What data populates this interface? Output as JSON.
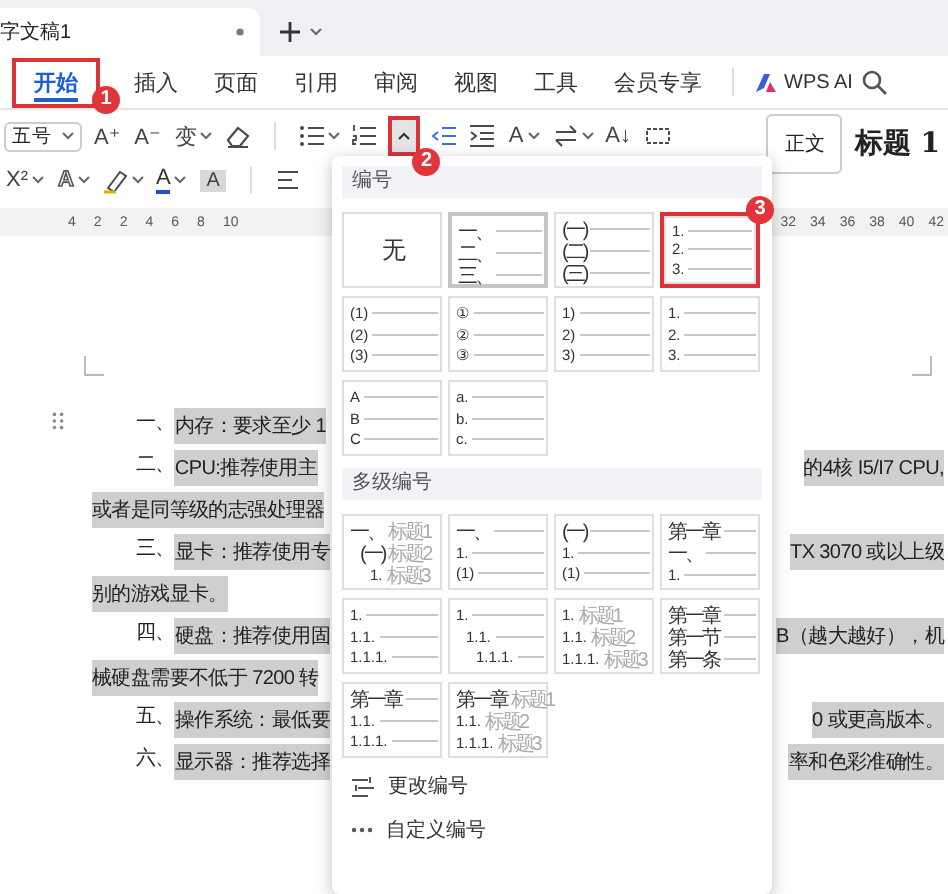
{
  "document_tab": {
    "title": "字文稿1"
  },
  "ribbon_tabs": [
    {
      "label": "开始",
      "selected": true,
      "callout": "1"
    },
    {
      "label": "插入",
      "selected": false
    },
    {
      "label": "页面",
      "selected": false
    },
    {
      "label": "引用",
      "selected": false
    },
    {
      "label": "审阅",
      "selected": false
    },
    {
      "label": "视图",
      "selected": false
    },
    {
      "label": "工具",
      "selected": false
    },
    {
      "label": "会员专享",
      "selected": false
    }
  ],
  "ai_button": {
    "label": "WPS AI"
  },
  "toolbar": {
    "font_size": "五号",
    "glyphs": [
      {
        "label": "A⁺",
        "kind": "plain"
      },
      {
        "label": "A⁻",
        "kind": "plain"
      },
      {
        "label": "变",
        "kind": "plain"
      },
      {
        "label": "A",
        "kind": "plain"
      },
      {
        "label": "A↓",
        "kind": "plain"
      },
      {
        "label": "X²",
        "kind": "plain"
      },
      {
        "label": "A",
        "kind": "outline"
      },
      {
        "label": "A",
        "kind": "underline"
      },
      {
        "label": "A",
        "kind": "shaded"
      }
    ],
    "numbering_toggle": {
      "expanded": true,
      "callout": "2"
    }
  },
  "styles": [
    {
      "label": "正文",
      "kind": "normal"
    },
    {
      "label": "标题 1",
      "kind": "heading"
    }
  ],
  "ruler": {
    "left_ticks": [
      "4",
      "2",
      "2",
      "4",
      "6",
      "8",
      "10"
    ],
    "right_ticks": [
      "32",
      "34",
      "36",
      "38",
      "40",
      "42"
    ]
  },
  "document": {
    "lines": [
      {
        "prefix": "一、",
        "left": "内存：要求至少 1"
      },
      {
        "prefix": "二、",
        "left": "CPU:推荐使用主",
        "right": "的4核 I5/I7 CPU,"
      },
      {
        "left": "或者是同等级的志强处理器"
      },
      {
        "prefix": "三、",
        "left": "显卡：推荐使用专",
        "right": "TX 3070 或以上级"
      },
      {
        "left": "别的游戏显卡。"
      },
      {
        "prefix": "四、",
        "left": "硬盘：推荐使用固",
        "right": "B（越大越好），机"
      },
      {
        "left": "械硬盘需要不低于 7200 转"
      },
      {
        "prefix": "五、",
        "left": "操作系统：最低要",
        "right": "0 或更高版本。"
      },
      {
        "prefix": "六、",
        "left": "显示器：推荐选择",
        "right": "率和色彩准确性。"
      }
    ]
  },
  "numbering_menu": {
    "title": "编号",
    "options": [
      {
        "kind": "none",
        "label": "无",
        "selected": false
      },
      {
        "kind": "list",
        "lines": [
          "一、",
          "二、",
          "三、"
        ],
        "selected": true
      },
      {
        "kind": "list",
        "lines": [
          "(一)",
          "(二)",
          "(三)"
        ],
        "selected": false
      },
      {
        "kind": "list",
        "lines": [
          "1.",
          "2.",
          "3."
        ],
        "selected": false,
        "callout": "3"
      },
      {
        "kind": "list",
        "lines": [
          "(1)",
          "(2)",
          "(3)"
        ],
        "selected": false
      },
      {
        "kind": "list",
        "lines": [
          "①",
          "②",
          "③"
        ],
        "selected": false
      },
      {
        "kind": "list",
        "lines": [
          "1)",
          "2)",
          "3)"
        ],
        "selected": false
      },
      {
        "kind": "list",
        "lines": [
          "1.",
          "2.",
          "3."
        ],
        "selected": false
      },
      {
        "kind": "list",
        "lines": [
          "A",
          "B",
          "C"
        ],
        "selected": false
      },
      {
        "kind": "list",
        "lines": [
          "a.",
          "b.",
          "c."
        ],
        "selected": false
      }
    ],
    "multilevel_title": "多级编号",
    "multilevel_options": [
      {
        "kind": "stepped",
        "selected": false,
        "lines": [
          {
            "prefix": "一、",
            "caption": "标题1"
          },
          {
            "prefix": "(一)",
            "caption": "标题2"
          },
          {
            "prefix": "1.",
            "caption": "标题3"
          }
        ]
      },
      {
        "kind": "flat",
        "selected": false,
        "lines": [
          {
            "prefix": "一、"
          },
          {
            "prefix": "1."
          },
          {
            "prefix": "(1)"
          }
        ]
      },
      {
        "kind": "flat",
        "selected": false,
        "lines": [
          {
            "prefix": "(一)"
          },
          {
            "prefix": "1."
          },
          {
            "prefix": "(1)"
          }
        ]
      },
      {
        "kind": "flat",
        "selected": false,
        "lines": [
          {
            "prefix": "第一章"
          },
          {
            "prefix": "一、"
          },
          {
            "prefix": "1."
          }
        ]
      },
      {
        "kind": "flat",
        "selected": false,
        "lines": [
          {
            "prefix": "1."
          },
          {
            "prefix": "1.1."
          },
          {
            "prefix": "1.1.1."
          }
        ]
      },
      {
        "kind": "stepped",
        "selected": false,
        "lines": [
          {
            "prefix": "1."
          },
          {
            "prefix": "1.1."
          },
          {
            "prefix": "1.1.1."
          }
        ]
      },
      {
        "kind": "flat",
        "selected": false,
        "lines": [
          {
            "prefix": "1.",
            "caption": "标题1"
          },
          {
            "prefix": "1.1.",
            "caption": "标题2"
          },
          {
            "prefix": "1.1.1.",
            "caption": "标题3"
          }
        ]
      },
      {
        "kind": "flat",
        "selected": false,
        "lines": [
          {
            "prefix": "第一章"
          },
          {
            "prefix": "第一节"
          },
          {
            "prefix": "第一条"
          }
        ]
      },
      {
        "kind": "flat",
        "selected": false,
        "lines": [
          {
            "prefix": "第一章"
          },
          {
            "prefix": "1.1."
          },
          {
            "prefix": "1.1.1."
          }
        ]
      },
      {
        "kind": "flat",
        "selected": false,
        "lines": [
          {
            "prefix": "第一章",
            "caption": "标题1"
          },
          {
            "prefix": "1.1.",
            "caption": "标题2"
          },
          {
            "prefix": "1.1.1.",
            "caption": "标题3"
          }
        ]
      }
    ],
    "actions": [
      {
        "label": "更改编号",
        "kind": "change"
      },
      {
        "label": "自定义编号",
        "kind": "custom"
      }
    ]
  }
}
